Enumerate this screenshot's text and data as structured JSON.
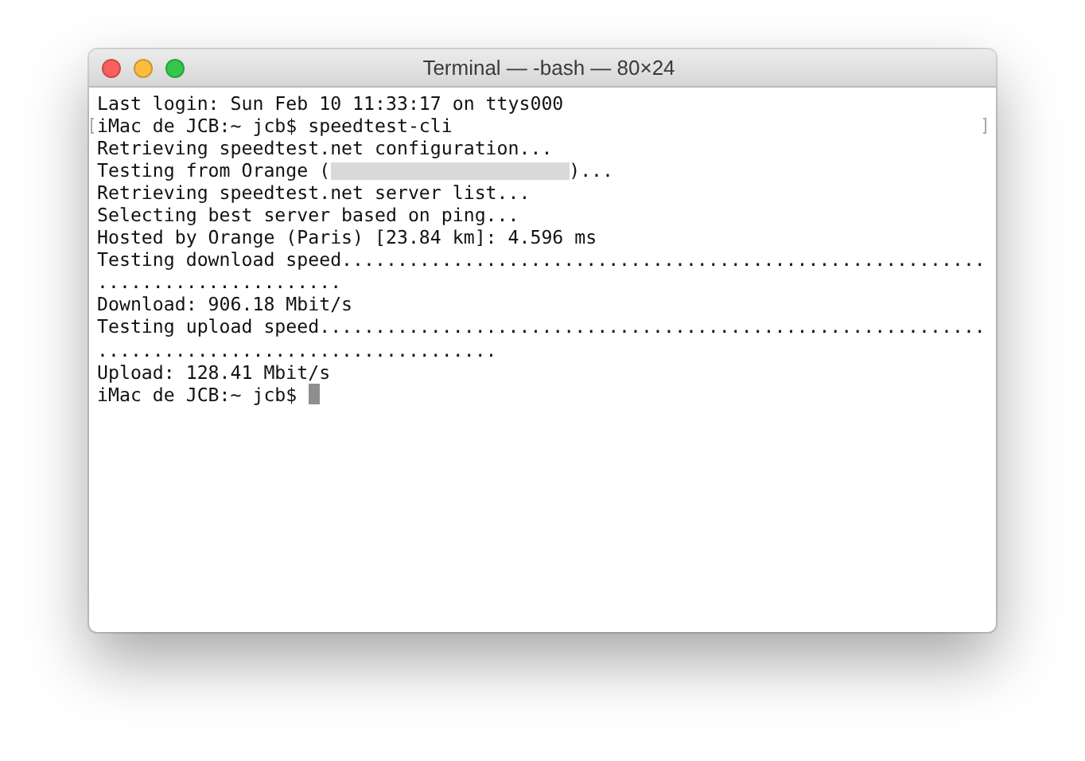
{
  "window": {
    "title": "Terminal — -bash — 80×24"
  },
  "lines": [
    {
      "kind": "text",
      "text": "Last login: Sun Feb 10 11:33:17 on ttys000",
      "marked": false
    },
    {
      "kind": "text",
      "text": "iMac de JCB:~ jcb$ speedtest-cli",
      "marked": true
    },
    {
      "kind": "text",
      "text": "Retrieving speedtest.net configuration...",
      "marked": false
    },
    {
      "kind": "redacted",
      "before": "Testing from Orange (",
      "after": ")...",
      "marked": false
    },
    {
      "kind": "text",
      "text": "Retrieving speedtest.net server list...",
      "marked": false
    },
    {
      "kind": "text",
      "text": "Selecting best server based on ping...",
      "marked": false
    },
    {
      "kind": "text",
      "text": "Hosted by Orange (Paris) [23.84 km]: 4.596 ms",
      "marked": false
    },
    {
      "kind": "text",
      "text": "Testing download speed..........................................................",
      "marked": false
    },
    {
      "kind": "text",
      "text": "......................",
      "marked": false
    },
    {
      "kind": "text",
      "text": "Download: 906.18 Mbit/s",
      "marked": false
    },
    {
      "kind": "text",
      "text": "Testing upload speed............................................................",
      "marked": false
    },
    {
      "kind": "text",
      "text": "....................................",
      "marked": false
    },
    {
      "kind": "text",
      "text": "Upload: 128.41 Mbit/s",
      "marked": false
    },
    {
      "kind": "prompt",
      "text": "iMac de JCB:~ jcb$ ",
      "marked": false
    }
  ]
}
